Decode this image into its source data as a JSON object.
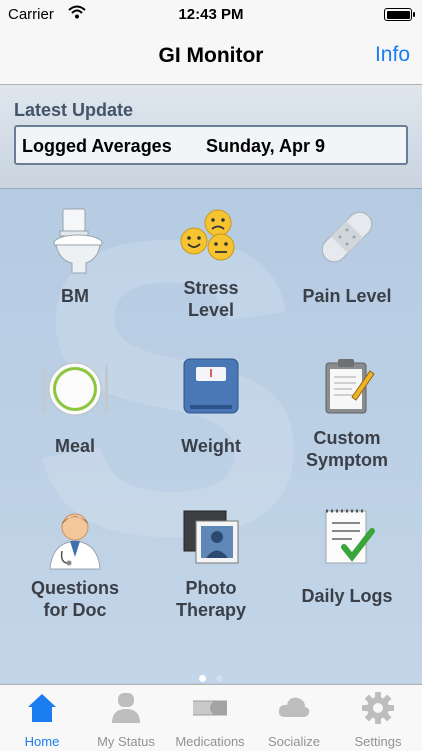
{
  "status": {
    "carrier": "Carrier",
    "time": "12:43 PM"
  },
  "nav": {
    "title": "GI Monitor",
    "info": "Info"
  },
  "latest": {
    "label": "Latest Update",
    "left": "Logged Averages",
    "right": "Sunday, Apr 9"
  },
  "tiles": [
    {
      "label": "BM",
      "icon": "toilet-icon"
    },
    {
      "label": "Stress\nLevel",
      "icon": "faces-icon"
    },
    {
      "label": "Pain Level",
      "icon": "bandage-icon"
    },
    {
      "label": "Meal",
      "icon": "plate-icon"
    },
    {
      "label": "Weight",
      "icon": "scale-icon"
    },
    {
      "label": "Custom\nSymptom",
      "icon": "clipboard-icon"
    },
    {
      "label": "Questions\nfor Doc",
      "icon": "doctor-icon"
    },
    {
      "label": "Photo\nTherapy",
      "icon": "photo-icon"
    },
    {
      "label": "Daily Logs",
      "icon": "checklist-icon"
    }
  ],
  "page_indicator": {
    "current": 1,
    "total": 2
  },
  "tabs": [
    {
      "label": "Home",
      "icon": "home-icon",
      "active": true
    },
    {
      "label": "My Status",
      "icon": "person-icon",
      "active": false
    },
    {
      "label": "Medications",
      "icon": "pill-icon",
      "active": false
    },
    {
      "label": "Socialize",
      "icon": "cloud-icon",
      "active": false
    },
    {
      "label": "Settings",
      "icon": "gear-icon",
      "active": false
    }
  ],
  "colors": {
    "accent": "#1a7ef0",
    "inactive": "#929292",
    "grid_bg": "#b9cde3"
  }
}
